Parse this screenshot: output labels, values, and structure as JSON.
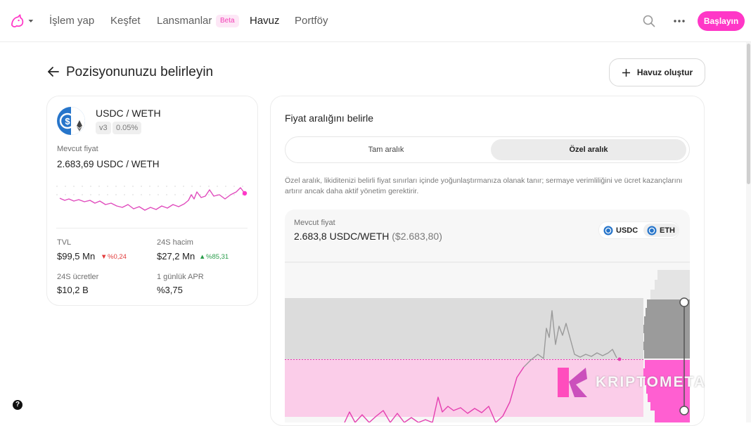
{
  "nav": {
    "logo_icon": "unicorn-icon",
    "items": [
      {
        "label": "İşlem yap"
      },
      {
        "label": "Keşfet"
      },
      {
        "label": "Lansmanlar"
      },
      {
        "label": "Havuz"
      },
      {
        "label": "Portföy"
      }
    ],
    "beta_label": "Beta",
    "active_item": "Havuz",
    "start_label": "Başlayın",
    "accent": "#ff37c7"
  },
  "header": {
    "title": "Pozisyonunuzu belirleyin",
    "create_label": "Havuz oluştur"
  },
  "pool": {
    "pair": "USDC / WETH",
    "version": "v3",
    "fee": "0.05%",
    "current_price_label": "Mevcut fiyat",
    "current_price": "2.683,69 USDC / WETH",
    "stats": [
      {
        "label": "TVL",
        "value": "$99,5 Mn",
        "delta": "%0,24",
        "direction": "down"
      },
      {
        "label": "24S hacim",
        "value": "$27,2 Mn",
        "delta": "%85,31",
        "direction": "up"
      },
      {
        "label": "24S ücretler",
        "value": "$10,2 B"
      },
      {
        "label": "1 günlük APR",
        "value": "%3,75"
      }
    ]
  },
  "range": {
    "title": "Fiyat aralığını belirle",
    "tabs": [
      {
        "label": "Tam aralık",
        "active": false
      },
      {
        "label": "Özel aralık",
        "active": true
      }
    ],
    "description": "Özel aralık, likiditenizi belirli fiyat sınırları içinde yoğunlaştırmanıza olanak tanır; sermaye verimliliğini ve ücret kazançlarını artırır ancak daha aktif yönetim gerektirir.",
    "chart_price_label": "Mevcut fiyat",
    "chart_price": "2.683,8 USDC/WETH",
    "chart_price_usd": "($2.683,80)",
    "tokens": [
      {
        "label": "USDC",
        "active": false
      },
      {
        "label": "ETH",
        "active": true
      }
    ]
  },
  "watermark": {
    "text": "KRIPTOMETA"
  },
  "help_label": "?"
}
